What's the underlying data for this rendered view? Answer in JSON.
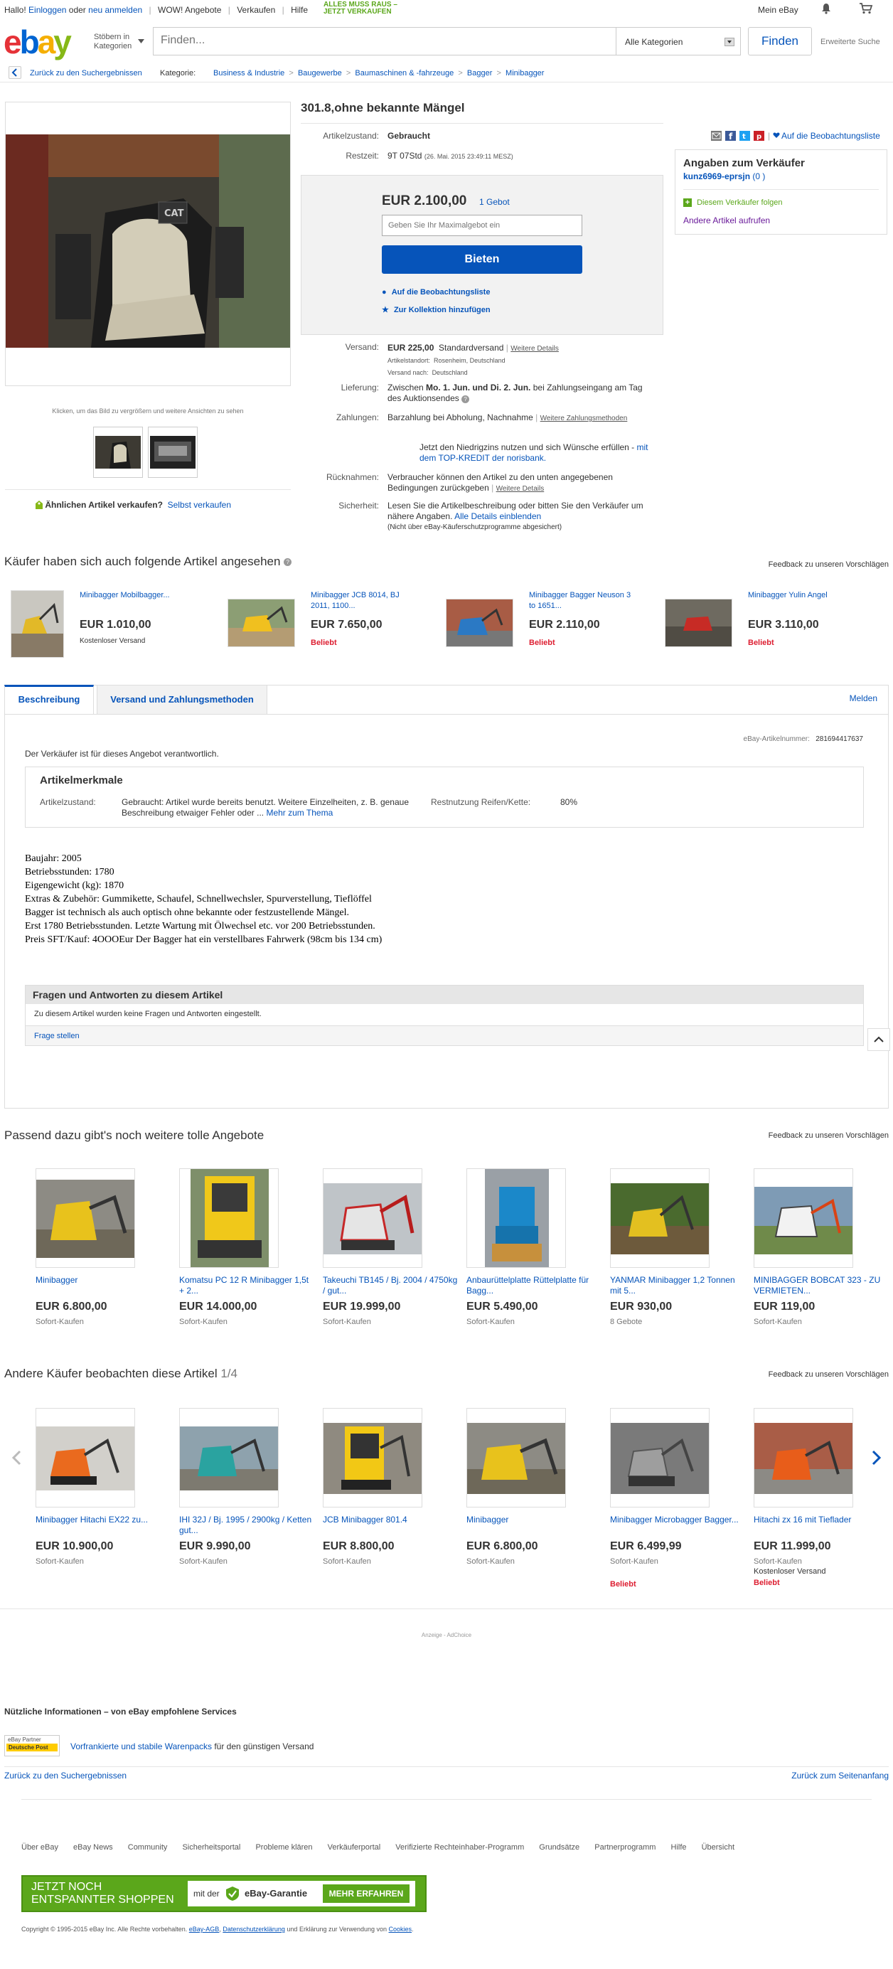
{
  "topbar": {
    "greeting": "Hallo!",
    "login": "Einloggen",
    "or": "oder",
    "register": "neu anmelden",
    "wow": "WOW! Angebote",
    "sell": "Verkaufen",
    "help": "Hilfe",
    "promo_line1": "ALLES MUSS RAUS –",
    "promo_line2": "JETZT VERKAUFEN",
    "my_ebay": "Mein eBay"
  },
  "header": {
    "browse_label": "Stöbern in Kategorien",
    "search_placeholder": "Finden...",
    "category_select": "Alle Kategorien",
    "search_button": "Finden",
    "advanced": "Erweiterte Suche"
  },
  "breadcrumb": {
    "back": "Zurück zu den Suchergebnissen",
    "category_label": "Kategorie:",
    "items": [
      "Business & Industrie",
      "Baugewerbe",
      "Baumaschinen & -fahrzeuge",
      "Bagger",
      "Minibagger"
    ]
  },
  "gallery": {
    "hint": "Klicken, um das Bild zu vergrößern und weitere Ansichten zu sehen",
    "sell_similar": "Ähnlichen Artikel verkaufen?",
    "sell_link": "Selbst verkaufen"
  },
  "item": {
    "title": "301.8,ohne bekannte Mängel",
    "condition_label": "Artikelzustand:",
    "condition_value": "Gebraucht",
    "time_label": "Restzeit:",
    "time_value": "9T 07Std",
    "time_end": "(26. Mai. 2015   23:49:11 MESZ)",
    "watch_link": "Auf die Beobachtungsliste",
    "price": "EUR 2.100,00",
    "bids": "1 Gebot",
    "max_bid_placeholder": "Geben Sie Ihr Maximalgebot ein",
    "bid_button": "Bieten",
    "add_watch": "Auf die Beobachtungsliste",
    "add_collection": "Zur Kollektion hinzufügen",
    "shipping_label": "Versand:",
    "shipping_price": "EUR 225,00",
    "shipping_type": "Standardversand",
    "shipping_details": "Weitere Details",
    "location_label": "Artikelstandort:",
    "location": "Rosenheim, Deutschland",
    "ship_to_label": "Versand nach:",
    "ship_to": "Deutschland",
    "delivery_label": "Lieferung:",
    "delivery_pre": "Zwischen",
    "delivery_dates": "Mo. 1. Jun. und Di. 2. Jun.",
    "delivery_post": "bei Zahlungseingang am Tag des Auktionsendes",
    "payment_label": "Zahlungen:",
    "payment_value": "Barzahlung bei Abholung,  Nachnahme",
    "payment_more": "Weitere Zahlungsmethoden",
    "credit_text": "Jetzt den Niedrigzins nutzen und sich Wünsche erfüllen -",
    "credit_link": "mit dem TOP-KREDIT der norisbank.",
    "returns_label": "Rücknahmen:",
    "returns_value": "Verbraucher können den Artikel zu den unten angegebenen Bedingungen zurückgeben",
    "returns_more": "Weitere Details",
    "safety_label": "Sicherheit:",
    "safety_value": "Lesen Sie die Artikelbeschreibung oder bitten Sie den Verkäufer um nähere Angaben.",
    "safety_link": "Alle Details einblenden",
    "safety_note": "(Nicht über eBay-Käuferschutzprogramme abgesichert)"
  },
  "seller": {
    "heading": "Angaben zum Verkäufer",
    "name": "kunz6969-eprsjn",
    "score": "(0 )",
    "follow": "Diesem Verkäufer folgen",
    "other_items": "Andere Artikel aufrufen"
  },
  "viewed": {
    "title": "Käufer haben sich auch folgende Artikel angesehen",
    "feedback": "Feedback zu unseren Vorschlägen",
    "items": [
      {
        "title": "Minibagger Mobilbagger...",
        "price": "EUR 1.010,00",
        "sub": "Kostenloser Versand",
        "badge": ""
      },
      {
        "title": "Minibagger JCB 8014, BJ 2011, 1100...",
        "price": "EUR 7.650,00",
        "sub": "",
        "badge": "Beliebt"
      },
      {
        "title": "Minibagger Bagger Neuson 3 to 1651...",
        "price": "EUR 2.110,00",
        "sub": "",
        "badge": "Beliebt"
      },
      {
        "title": "Minibagger Yulin Angel",
        "price": "EUR 3.110,00",
        "sub": "",
        "badge": "Beliebt"
      }
    ]
  },
  "tabs": {
    "description": "Beschreibung",
    "shipping": "Versand und Zahlungsmethoden",
    "report": "Melden"
  },
  "description": {
    "item_number_label": "eBay-Artikelnummer:",
    "item_number": "281694417637",
    "responsible": "Der Verkäufer ist für dieses Angebot verantwortlich.",
    "specs_title": "Artikelmerkmale",
    "cond_label": "Artikelzustand:",
    "cond_text": "Gebraucht: Artikel wurde bereits benutzt. Weitere Einzelheiten, z. B. genaue Beschreibung etwaiger Fehler oder ...",
    "cond_more": "Mehr zum Thema",
    "tire_label": "Restnutzung Reifen/Kette:",
    "tire_value": "80%",
    "lines": [
      "Baujahr: 2005",
      "Betriebsstunden: 1780",
      "Eigengewicht (kg): 1870",
      "Extras & Zubehör: Gummikette, Schaufel, Schnellwechsler, Spurverstellung, Tieflöffel",
      "Bagger ist technisch als auch optisch ohne bekannte oder festzustellende Mängel.",
      "Erst 1780 Betriebsstunden. Letzte Wartung mit Ölwechsel etc. vor 200 Betriebsstunden.",
      "Preis SFT/Kauf: 4OOOEur Der Bagger hat ein verstellbares Fahrwerk (98cm bis 134 cm)"
    ],
    "qa_title": "Fragen und Antworten zu diesem Artikel",
    "qa_empty": "Zu diesem Artikel wurden keine Fragen und Antworten eingestellt.",
    "qa_ask": "Frage stellen"
  },
  "matching": {
    "title": "Passend dazu gibt's noch weitere tolle Angebote",
    "feedback": "Feedback zu unseren Vorschlägen",
    "items": [
      {
        "title": "Minibagger",
        "price": "EUR 6.800,00",
        "sub": "Sofort-Kaufen"
      },
      {
        "title": "Komatsu PC 12 R Minibagger 1,5t + 2...",
        "price": "EUR 14.000,00",
        "sub": "Sofort-Kaufen"
      },
      {
        "title": "Takeuchi TB145 / Bj. 2004 / 4750kg / gut...",
        "price": "EUR 19.999,00",
        "sub": "Sofort-Kaufen"
      },
      {
        "title": "Anbaurüttelplatte Rüttelplatte für Bagg...",
        "price": "EUR 5.490,00",
        "sub": "Sofort-Kaufen"
      },
      {
        "title": "YANMAR Minibagger 1,2 Tonnen mit 5...",
        "price": "EUR 930,00",
        "sub": "8 Gebote"
      },
      {
        "title": "MINIBAGGER BOBCAT 323 - ZU VERMIETEN...",
        "price": "EUR 119,00",
        "sub": "Sofort-Kaufen"
      }
    ]
  },
  "watched": {
    "title": "Andere Käufer beobachten diese Artikel",
    "page": "1/4",
    "feedback": "Feedback zu unseren Vorschlägen",
    "items": [
      {
        "title": "Minibagger Hitachi EX22 zu...",
        "price": "EUR 10.900,00",
        "sub": "Sofort-Kaufen",
        "extra": "",
        "badge": ""
      },
      {
        "title": "IHI 32J / Bj. 1995 / 2900kg / Ketten gut...",
        "price": "EUR 9.990,00",
        "sub": "Sofort-Kaufen",
        "extra": "",
        "badge": ""
      },
      {
        "title": "JCB Minibagger 801.4",
        "price": "EUR 8.800,00",
        "sub": "Sofort-Kaufen",
        "extra": "",
        "badge": ""
      },
      {
        "title": "Minibagger",
        "price": "EUR 6.800,00",
        "sub": "Sofort-Kaufen",
        "extra": "",
        "badge": ""
      },
      {
        "title": "Minibagger Microbagger Bagger...",
        "price": "EUR 6.499,99",
        "sub": "Sofort-Kaufen",
        "extra": "",
        "badge": "Beliebt"
      },
      {
        "title": "Hitachi zx 16 mit Tieflader",
        "price": "EUR 11.999,00",
        "sub": "Sofort-Kaufen",
        "extra": "Kostenloser Versand",
        "badge": "Beliebt"
      }
    ]
  },
  "ad_label": "Anzeige - AdChoice",
  "services": {
    "title": "Nützliche Informationen – von eBay empfohlene Services",
    "partner_label": "eBay Partner",
    "partner_name": "Deutsche Post",
    "link": "Vorfrankierte und stabile Warenpacks",
    "text": "für den günstigen Versand"
  },
  "bottom_nav": {
    "back": "Zurück zu den Suchergebnissen",
    "top": "Zurück zum Seitenanfang"
  },
  "footer": {
    "links": [
      "Über eBay",
      "eBay News",
      "Community",
      "Sicherheitsportal",
      "Probleme klären",
      "Verkäuferportal",
      "Verifizierte Rechteinhaber-Programm",
      "Grundsätze",
      "Partnerprogramm",
      "Hilfe",
      "Übersicht"
    ],
    "banner_line1": "JETZT NOCH",
    "banner_line2": "ENTSPANNTER SHOPPEN",
    "banner_mid_pre": "mit der",
    "banner_mid": "eBay-Garantie",
    "banner_btn": "MEHR ERFAHREN",
    "copyright": "Copyright © 1995-2015 eBay Inc. Alle Rechte vorbehalten.",
    "agb": "eBay-AGB",
    "privacy": "Datenschutzerklärung",
    "cookies_pre": "und Erklärung zur Verwendung von",
    "cookies": "Cookies"
  },
  "colors": {
    "link": "#0654ba",
    "bid_button": "#0654ba",
    "promo": "#5ba71b",
    "badge_red": "#dd1e31",
    "footer_green": "#5ba71b"
  }
}
